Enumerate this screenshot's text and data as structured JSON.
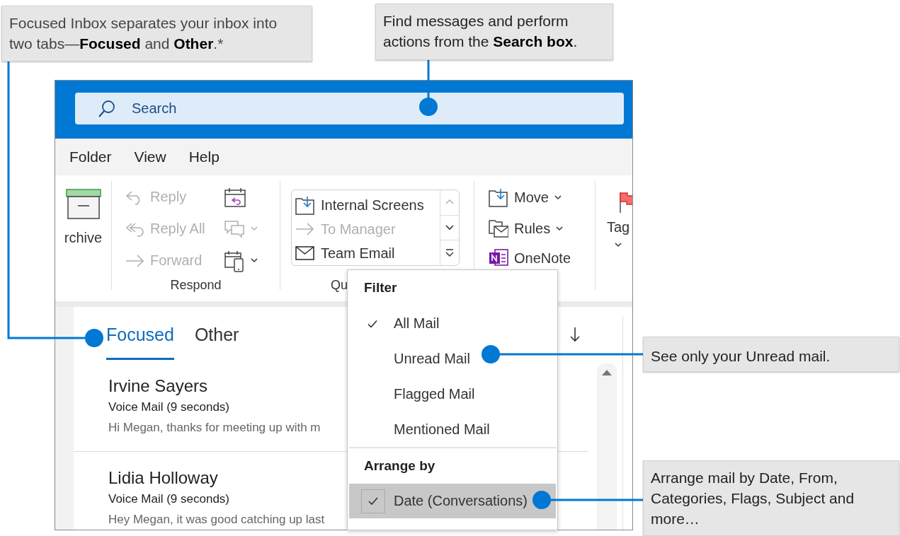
{
  "callouts": [
    {
      "text": "Focused Inbox separates your inbox into two tabs—**Focused** and **Other**.*"
    },
    {
      "text": "Find messages and perform actions from the **Search box**."
    },
    {
      "text": "See only your Unread mail."
    },
    {
      "text": "Arrange mail by Date, From, Categories, Flags, Subject and more…"
    }
  ],
  "search": {
    "placeholder": "Search"
  },
  "menu_bar": [
    "Folder",
    "View",
    "Help"
  ],
  "ribbon": {
    "archive": {
      "label": "rchive"
    },
    "respond": {
      "label": "Respond",
      "commands": [
        {
          "label": "Reply",
          "disabled": true
        },
        {
          "label": "Reply All",
          "disabled": true
        },
        {
          "label": "Forward",
          "disabled": true
        }
      ]
    },
    "quick_steps": {
      "label": "Qu",
      "items": [
        {
          "label": "Internal Screens",
          "disabled": false
        },
        {
          "label": "To Manager",
          "disabled": true
        },
        {
          "label": "Team Email",
          "disabled": false
        }
      ]
    },
    "move": {
      "commands": [
        {
          "label": "Move",
          "dropdown": true
        },
        {
          "label": "Rules",
          "dropdown": true
        },
        {
          "label": "OneNote",
          "dropdown": false
        }
      ]
    },
    "tags": {
      "label": "Tag"
    }
  },
  "tabs": [
    {
      "label": "Focused",
      "selected": true
    },
    {
      "label": "Other",
      "selected": false
    }
  ],
  "messages": [
    {
      "sender": "Irvine Sayers",
      "subject": "Voice Mail (9 seconds)",
      "preview": "Hi Megan, thanks for meeting up with m"
    },
    {
      "sender": "Lidia Holloway",
      "subject": "Voice Mail (9 seconds)",
      "preview": "Hey Megan, it was good catching up last"
    }
  ],
  "menu": {
    "sections": [
      {
        "title": "Filter",
        "items": [
          {
            "label": "All Mail",
            "checked": true,
            "selected": false
          },
          {
            "label": "Unread Mail",
            "checked": false,
            "selected": false
          },
          {
            "label": "Flagged Mail",
            "checked": false,
            "selected": false
          },
          {
            "label": "Mentioned Mail",
            "checked": false,
            "selected": false
          }
        ]
      },
      {
        "title": "Arrange by",
        "items": [
          {
            "label": "Date (Conversations)",
            "checked": true,
            "selected": true
          }
        ]
      }
    ]
  }
}
